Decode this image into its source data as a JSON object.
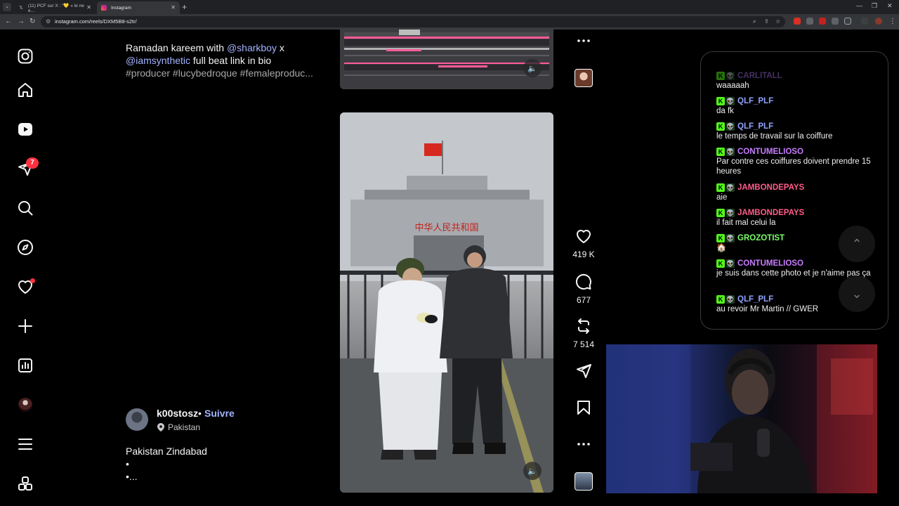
{
  "browser": {
    "tabs": [
      {
        "title": "(11) PCF sur X : \"💛 « le ne e…",
        "active": false
      },
      {
        "title": "Instagram",
        "active": true
      }
    ],
    "url": "instagram.com/reels/DXM5B8-s2tr/"
  },
  "sidebar": {
    "items": [
      {
        "name": "instagram-logo-icon"
      },
      {
        "name": "home-icon"
      },
      {
        "name": "reels-icon"
      },
      {
        "name": "messages-icon",
        "badge": "7"
      },
      {
        "name": "search-icon"
      },
      {
        "name": "explore-icon"
      },
      {
        "name": "notifications-icon",
        "dot": true
      },
      {
        "name": "create-icon"
      },
      {
        "name": "dashboard-icon"
      },
      {
        "name": "profile-icon"
      },
      {
        "name": "more-icon"
      },
      {
        "name": "meta-apps-icon"
      }
    ]
  },
  "reel_top": {
    "caption_line1_pre": "Ramadan kareem with ",
    "caption_mention1": "@sharkboy",
    "caption_line1_post": " x",
    "caption_mention2": "@iamsynthetic",
    "caption_line2_post": " full beat link in bio",
    "caption_hashtags": "#producer #lucybedroque #femaleproduc..."
  },
  "reel_main": {
    "author": "k00stosz",
    "separator": "•",
    "follow": "Suivre",
    "location": "Pakistan",
    "caption_line1": "Pakistan Zindabad",
    "caption_line2": "•",
    "caption_line3": "•...",
    "sign_text": "中华人民共和国",
    "likes": "419 K",
    "comments": "677",
    "reposts": "7 514"
  },
  "chat": {
    "messages": [
      {
        "user": "CARLITALL",
        "text": "waaaaah",
        "color": "#9b6bd6",
        "faded": true
      },
      {
        "user": "QLF_PLF",
        "text": "da fk",
        "color": "#8fa3ff"
      },
      {
        "user": "QLF_PLF",
        "text": "le temps de travail sur la coiffure",
        "color": "#8fa3ff"
      },
      {
        "user": "CONTUMELIOSO",
        "text": "Par contre ces coiffures doivent prendre 15 heures",
        "color": "#c77dff"
      },
      {
        "user": "JAMBONDEPAYS",
        "text": "aie",
        "color": "#ff5c8a"
      },
      {
        "user": "JAMBONDEPAYS",
        "text": "il fait mal celui la",
        "color": "#ff5c8a"
      },
      {
        "user": "GROZOTIST",
        "text": "🏠",
        "color": "#7dff6b"
      },
      {
        "user": "CONTUMELIOSO",
        "text": "je suis dans cette photo et je n'aime pas ça",
        "color": "#c77dff"
      },
      {
        "user": "QLF_PLF",
        "text": "au revoir Mr Martin // GWER",
        "color": "#8fa3ff"
      }
    ]
  },
  "colors": {
    "background": "#000000",
    "link": "#a3b4ff",
    "badge": "#ff3040",
    "kick_green": "#53fc18"
  }
}
